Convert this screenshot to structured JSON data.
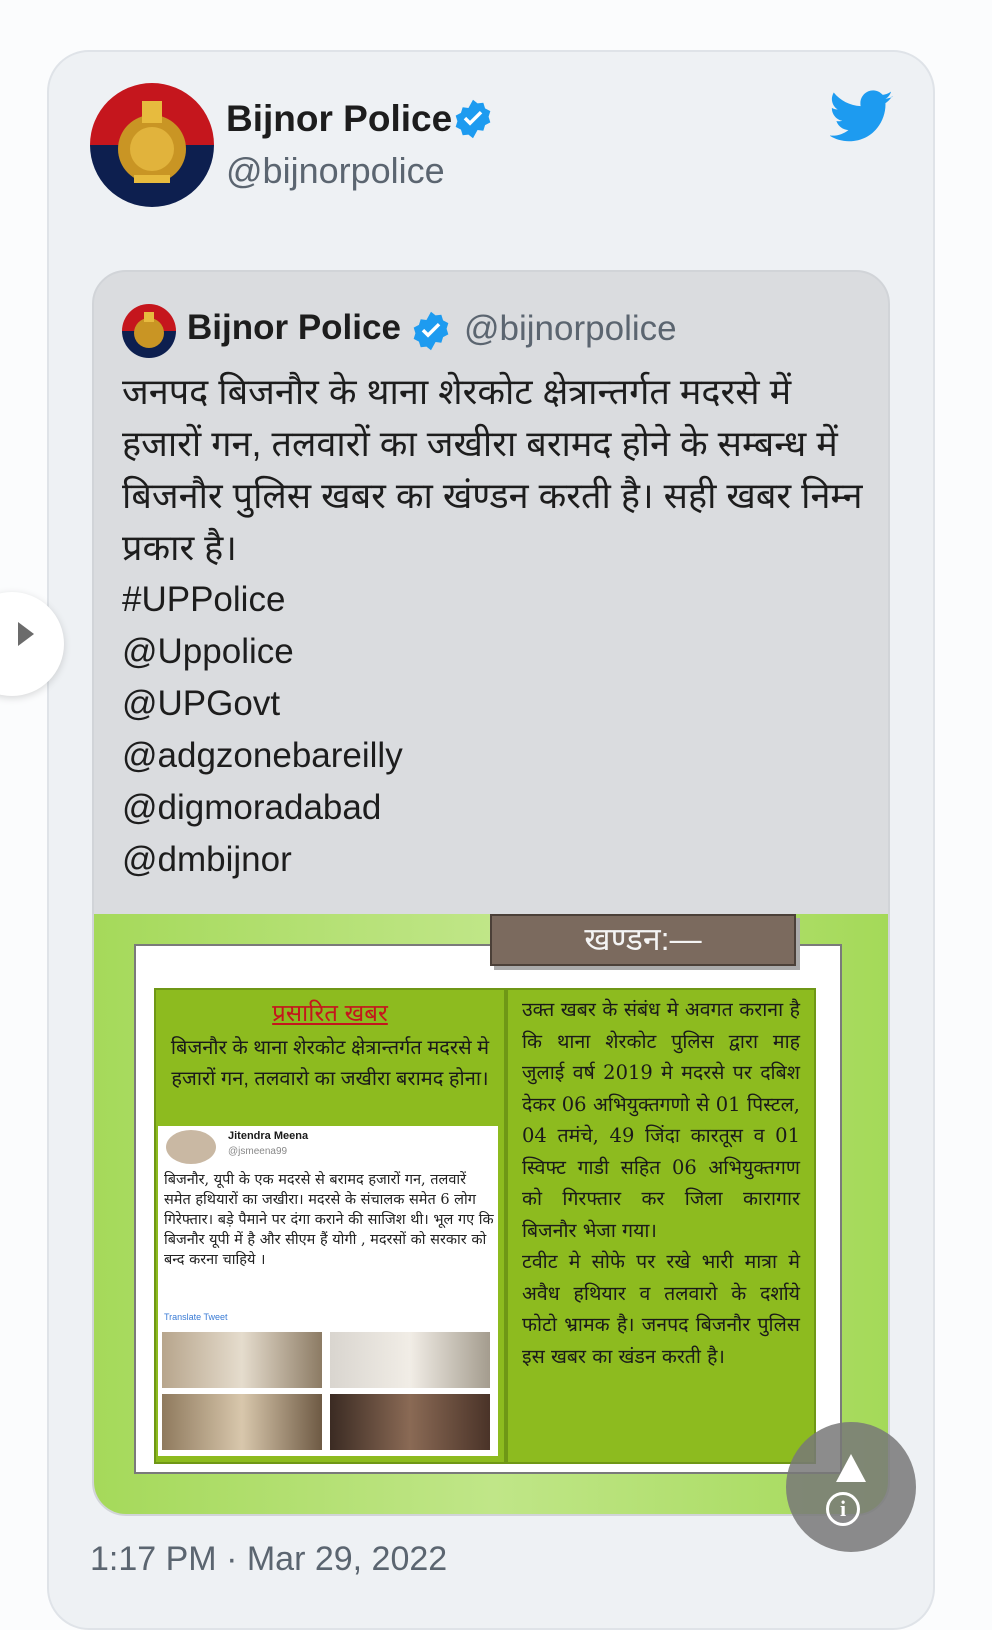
{
  "tweet": {
    "author_name": "Bijnor Police",
    "author_handle": "@bijnorpolice",
    "timestamp": "1:17 PM · Mar 29, 2022"
  },
  "quoted": {
    "author_name": "Bijnor Police",
    "author_handle": "@bijnorpolice",
    "text": "जनपद बिजनौर के थाना शेरकोट क्षेत्रान्तर्गत मदरसे में हजारों गन, तलवारों का जखीरा बरामद होने के सम्बन्ध में बिजनौर पुलिस खबर का खंण्डन करती है। सही खबर निम्न प्रकार है।",
    "tags": [
      "#UPPolice",
      "@Uppolice",
      "@UPGovt",
      "@adgzonebareilly",
      "@digmoradabad",
      "@dmbijnor"
    ]
  },
  "media": {
    "khandan": "खण्डन:—",
    "left_title": "प्रसारित खबर",
    "left_head": "बिजनौर के थाना शेरकोट क्षेत्रान्तर्गत मदरसे मे हजारों गन, तलवारो का जखीरा बरामद होना।",
    "shot_name": "Jitendra Meena",
    "shot_handle": "@jsmeena99",
    "shot_text": "बिजनौर, यूपी के एक मदरसे से बरामद हजारों गन, तलवारें समेत हथियारों का जखीरा। मदरसे के संचालक समेत 6 लोग गिरेफ्तार। बड़े पैमाने पर दंगा कराने की साजिश थी। भूल गए कि बिजनौर यूपी में है और सीएम हैं योगी , मदरसों को सरकार को बन्द करना चाहिये ।",
    "shot_translate": "Translate Tweet",
    "right_text_1": "उक्त खबर के संबंध मे अवगत कराना है कि थाना शेरकोट पुलिस द्वारा माह जुलाई वर्ष 2019 मे मदरसे पर दबिश देकर 06 अभियुक्तगणो से 01 पिस्टल, 04 तमंचे, 49 जिंदा कारतूस व 01 स्विफ्ट गाडी सहित 06 अभियुक्तगण को गिरफ्तार कर जिला कारागार बिजनौर भेजा गया।",
    "right_text_2": "टवीट मे सोफे पर रखे भारी मात्रा मे अवैध हथियार व तलवारो के दर्शाये फोटो भ्रामक है। जनपद बिजनौर पुलिस इस खबर का खंडन करती है।"
  },
  "colors": {
    "twitter_blue": "#1d9bf0",
    "green": "#8dbb1f",
    "khandan_bg": "#7b6a5e"
  },
  "icons": {
    "verified": "verified-badge-icon",
    "twitter": "twitter-bird-icon",
    "side": "play-arrow-icon",
    "fab_up": "scroll-up-icon",
    "fab_info": "info-icon"
  }
}
